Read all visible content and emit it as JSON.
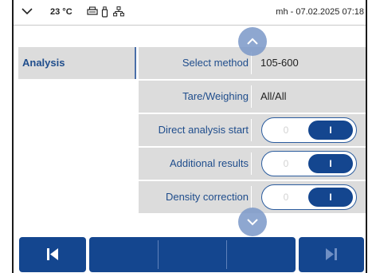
{
  "status_bar": {
    "temperature": "23 °C",
    "user_datetime": "mh - 07.02.2025 07:18",
    "icons": [
      "chevron-down-icon",
      "printer-icon",
      "usb-stick-icon",
      "network-icon"
    ]
  },
  "sidebar": {
    "items": [
      {
        "label": "Analysis",
        "selected": true
      }
    ]
  },
  "settings": {
    "rows": [
      {
        "label": "Select method",
        "value": "105-600"
      },
      {
        "label": "Tare/Weighing",
        "value": "All/All"
      },
      {
        "label": "Direct analysis start",
        "toggle_off": "0",
        "toggle_on": "I",
        "state": "on"
      },
      {
        "label": "Additional results",
        "toggle_off": "0",
        "toggle_on": "I",
        "state": "on"
      },
      {
        "label": "Density correction",
        "toggle_off": "0",
        "toggle_on": "I",
        "state": "on"
      }
    ]
  },
  "colors": {
    "accent": "#14468f",
    "label_text": "#1f4d8c",
    "row_bg": "#dcdcdc",
    "scroll_button": "#7a98c8"
  },
  "nav": {
    "icons": [
      "skip-back-icon",
      "skip-forward-icon"
    ]
  }
}
